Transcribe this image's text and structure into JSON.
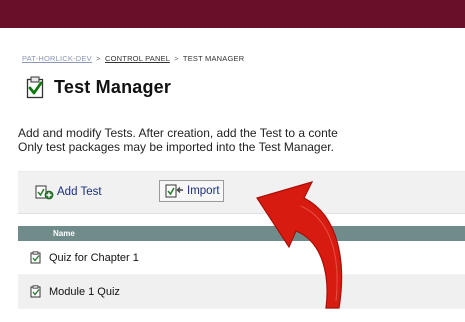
{
  "breadcrumb": {
    "course": "PAT-HORLICK-DEV",
    "control_panel": "CONTROL PANEL",
    "current": "TEST MANAGER",
    "separator": ">"
  },
  "page": {
    "title": "Test Manager",
    "description_line1": "Add and modify Tests. After creation, add the Test to a conte",
    "description_line2": "Only test packages may be imported into the Test Manager."
  },
  "toolbar": {
    "add_label": "Add Test",
    "import_label": "Import"
  },
  "table": {
    "header": "Name",
    "rows": [
      {
        "name": "Quiz for Chapter 1"
      },
      {
        "name": "Module 1 Quiz"
      }
    ]
  },
  "colors": {
    "top_bar": "#6a0f2a",
    "table_header": "#6f8b8a",
    "toolbar_bg": "#f1f1f1",
    "arrow_red": "#d81b10"
  },
  "icons": {
    "title": "checklist-icon",
    "add": "add-test-icon",
    "import": "import-icon",
    "rows": "test-item-icon",
    "annotation": "red-curved-arrow"
  }
}
